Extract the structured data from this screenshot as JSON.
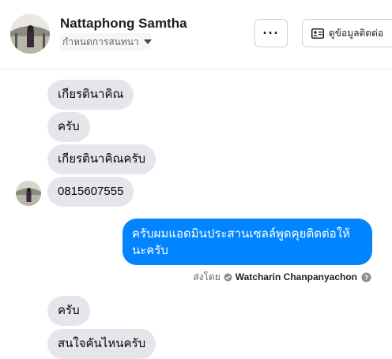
{
  "header": {
    "contact_name": "Nattaphong Samtha",
    "status": "กำหนดการสนทนา",
    "more_label": "···",
    "contact_info_label": "ดูข้อมูลติดต่อ"
  },
  "messages": [
    {
      "direction": "in",
      "text": "เกียรตินาคิณ"
    },
    {
      "direction": "in",
      "text": "ครับ"
    },
    {
      "direction": "in",
      "text": "เกียรตินาคิณครับ"
    },
    {
      "direction": "in",
      "text": "0815607555"
    },
    {
      "direction": "out",
      "text": "ครับผมแอดมินประสานเซลล์พูดคุยติดต่อให้นะครับ"
    },
    {
      "direction": "in",
      "text": "ครับ"
    },
    {
      "direction": "in",
      "text": "สนใจคันไหนครับ"
    }
  ],
  "sent_by": {
    "prefix": "ส่งโดย",
    "name": "Watcharin Chanpanyachon"
  },
  "colors": {
    "outgoing": "#0084ff",
    "incoming": "#e4e6eb"
  }
}
